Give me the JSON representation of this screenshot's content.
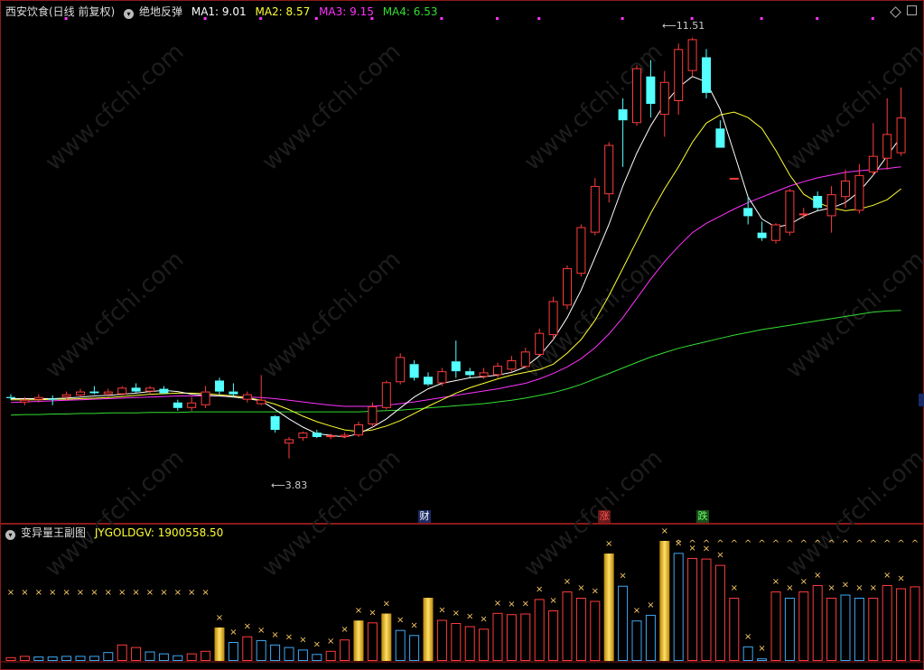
{
  "main_header": {
    "title": "西安饮食(日线 前复权)",
    "indicator_name": "绝地反弹",
    "ma1": "MA1: 9.01",
    "ma2": "MA2: 8.57",
    "ma3": "MA3: 9.15",
    "ma4": "MA4: 6.53"
  },
  "sub_header": {
    "title": "变异量王副图",
    "value": "JYGOLDGV: 1900558.50"
  },
  "markers": {
    "high_label": "11.51",
    "low_label": "3.83",
    "cai": "财",
    "zhang": "涨",
    "die": "跌"
  },
  "watermark": "www.cfchi.com",
  "colors": {
    "up": "#ff3c3c",
    "down": "#54ffff",
    "ma1": "#ffffff",
    "ma2": "#ffff33",
    "ma3": "#ff33ff",
    "ma4": "#33dd33",
    "frame": "#8b1a1a",
    "gold": "#f2c12e",
    "vol_up": "#ff3c3c",
    "vol_down": "#3fa9f5"
  },
  "chart_data": {
    "type": "candlestick",
    "price_range": [
      3.0,
      11.8
    ],
    "candles": [
      {
        "o": 4.95,
        "h": 5.0,
        "l": 4.9,
        "c": 4.93
      },
      {
        "o": 4.85,
        "h": 4.95,
        "l": 4.8,
        "c": 4.9
      },
      {
        "o": 4.9,
        "h": 5.0,
        "l": 4.85,
        "c": 4.95
      },
      {
        "o": 4.92,
        "h": 4.98,
        "l": 4.8,
        "c": 4.9
      },
      {
        "o": 4.95,
        "h": 5.05,
        "l": 4.9,
        "c": 5.0
      },
      {
        "o": 4.98,
        "h": 5.1,
        "l": 4.95,
        "c": 5.05
      },
      {
        "o": 5.05,
        "h": 5.15,
        "l": 5.0,
        "c": 5.02
      },
      {
        "o": 5.0,
        "h": 5.1,
        "l": 4.95,
        "c": 5.05
      },
      {
        "o": 5.0,
        "h": 5.15,
        "l": 4.98,
        "c": 5.12
      },
      {
        "o": 5.12,
        "h": 5.2,
        "l": 5.02,
        "c": 5.05
      },
      {
        "o": 5.05,
        "h": 5.15,
        "l": 5.0,
        "c": 5.12
      },
      {
        "o": 5.1,
        "h": 5.15,
        "l": 5.0,
        "c": 5.02
      },
      {
        "o": 4.85,
        "h": 4.9,
        "l": 4.7,
        "c": 4.75
      },
      {
        "o": 4.75,
        "h": 4.95,
        "l": 4.7,
        "c": 4.85
      },
      {
        "o": 4.8,
        "h": 5.15,
        "l": 4.75,
        "c": 5.05
      },
      {
        "o": 5.25,
        "h": 5.3,
        "l": 5.0,
        "c": 5.05
      },
      {
        "o": 5.05,
        "h": 5.2,
        "l": 4.95,
        "c": 5.0
      },
      {
        "o": 4.9,
        "h": 5.05,
        "l": 4.85,
        "c": 5.0
      },
      {
        "o": 4.82,
        "h": 5.35,
        "l": 4.8,
        "c": 4.9
      },
      {
        "o": 4.6,
        "h": 4.62,
        "l": 4.3,
        "c": 4.35
      },
      {
        "o": 4.1,
        "h": 4.22,
        "l": 3.83,
        "c": 4.18
      },
      {
        "o": 4.2,
        "h": 4.32,
        "l": 4.15,
        "c": 4.3
      },
      {
        "o": 4.3,
        "h": 4.35,
        "l": 4.2,
        "c": 4.22
      },
      {
        "o": 4.22,
        "h": 4.28,
        "l": 4.18,
        "c": 4.25
      },
      {
        "o": 4.22,
        "h": 4.3,
        "l": 4.2,
        "c": 4.26
      },
      {
        "o": 4.25,
        "h": 4.5,
        "l": 4.22,
        "c": 4.45
      },
      {
        "o": 4.45,
        "h": 4.85,
        "l": 4.4,
        "c": 4.78
      },
      {
        "o": 4.75,
        "h": 5.25,
        "l": 4.72,
        "c": 5.22
      },
      {
        "o": 5.22,
        "h": 5.75,
        "l": 5.18,
        "c": 5.68
      },
      {
        "o": 5.55,
        "h": 5.62,
        "l": 5.25,
        "c": 5.3
      },
      {
        "o": 5.32,
        "h": 5.4,
        "l": 5.15,
        "c": 5.18
      },
      {
        "o": 5.2,
        "h": 5.48,
        "l": 5.15,
        "c": 5.42
      },
      {
        "o": 5.6,
        "h": 5.98,
        "l": 5.3,
        "c": 5.42
      },
      {
        "o": 5.42,
        "h": 5.48,
        "l": 5.3,
        "c": 5.35
      },
      {
        "o": 5.32,
        "h": 5.48,
        "l": 5.28,
        "c": 5.4
      },
      {
        "o": 5.35,
        "h": 5.58,
        "l": 5.3,
        "c": 5.52
      },
      {
        "o": 5.45,
        "h": 5.7,
        "l": 5.4,
        "c": 5.62
      },
      {
        "o": 5.5,
        "h": 5.85,
        "l": 5.48,
        "c": 5.78
      },
      {
        "o": 5.72,
        "h": 6.2,
        "l": 5.7,
        "c": 6.12
      },
      {
        "o": 6.08,
        "h": 6.78,
        "l": 6.0,
        "c": 6.7
      },
      {
        "o": 6.62,
        "h": 7.35,
        "l": 6.55,
        "c": 7.3
      },
      {
        "o": 7.2,
        "h": 8.1,
        "l": 7.15,
        "c": 8.05
      },
      {
        "o": 7.95,
        "h": 8.95,
        "l": 7.9,
        "c": 8.8
      },
      {
        "o": 8.65,
        "h": 9.6,
        "l": 8.5,
        "c": 9.55
      },
      {
        "o": 10.2,
        "h": 10.4,
        "l": 9.15,
        "c": 10.0
      },
      {
        "o": 9.95,
        "h": 11.0,
        "l": 9.9,
        "c": 10.95
      },
      {
        "o": 10.8,
        "h": 11.1,
        "l": 10.05,
        "c": 10.3
      },
      {
        "o": 10.1,
        "h": 10.9,
        "l": 9.7,
        "c": 10.7
      },
      {
        "o": 10.35,
        "h": 11.4,
        "l": 10.1,
        "c": 11.3
      },
      {
        "o": 10.9,
        "h": 11.51,
        "l": 10.8,
        "c": 11.48
      },
      {
        "o": 11.15,
        "h": 11.3,
        "l": 10.4,
        "c": 10.5
      },
      {
        "o": 9.85,
        "h": 10.0,
        "l": 9.5,
        "c": 9.5
      },
      {
        "o": 8.95,
        "h": 8.95,
        "l": 8.95,
        "c": 8.95
      },
      {
        "o": 8.4,
        "h": 8.6,
        "l": 8.1,
        "c": 8.25
      },
      {
        "o": 7.95,
        "h": 8.15,
        "l": 7.8,
        "c": 7.85
      },
      {
        "o": 7.8,
        "h": 8.12,
        "l": 7.75,
        "c": 8.1
      },
      {
        "o": 7.95,
        "h": 8.75,
        "l": 7.9,
        "c": 8.72
      },
      {
        "o": 8.3,
        "h": 8.4,
        "l": 8.2,
        "c": 8.3
      },
      {
        "o": 8.62,
        "h": 8.7,
        "l": 8.35,
        "c": 8.4
      },
      {
        "o": 8.25,
        "h": 8.8,
        "l": 7.95,
        "c": 8.65
      },
      {
        "o": 8.6,
        "h": 9.1,
        "l": 8.4,
        "c": 8.9
      },
      {
        "o": 8.35,
        "h": 9.2,
        "l": 8.3,
        "c": 9.0
      },
      {
        "o": 9.05,
        "h": 9.95,
        "l": 9.0,
        "c": 9.35
      },
      {
        "o": 9.3,
        "h": 10.4,
        "l": 9.1,
        "c": 9.75
      },
      {
        "o": 9.4,
        "h": 10.6,
        "l": 9.35,
        "c": 10.05
      }
    ],
    "ma1": [
      4.92,
      4.92,
      4.92,
      4.92,
      4.93,
      4.95,
      4.97,
      4.98,
      5.0,
      5.02,
      5.05,
      5.07,
      5.05,
      5.0,
      4.98,
      4.97,
      4.95,
      4.92,
      4.88,
      4.72,
      4.55,
      4.4,
      4.28,
      4.25,
      4.22,
      4.28,
      4.4,
      4.55,
      4.75,
      4.95,
      5.1,
      5.2,
      5.25,
      5.3,
      5.32,
      5.35,
      5.4,
      5.5,
      5.7,
      6.0,
      6.4,
      6.9,
      7.5,
      8.1,
      8.8,
      9.4,
      9.9,
      10.3,
      10.6,
      10.8,
      10.7,
      10.2,
      9.4,
      8.6,
      8.2,
      8.05,
      8.1,
      8.25,
      8.35,
      8.4,
      8.5,
      8.7,
      9.0,
      9.35,
      9.7
    ],
    "ma2": [
      4.9,
      4.9,
      4.9,
      4.91,
      4.91,
      4.92,
      4.93,
      4.94,
      4.96,
      4.98,
      5.0,
      5.01,
      5.02,
      5.02,
      5.01,
      4.99,
      4.97,
      4.94,
      4.89,
      4.82,
      4.72,
      4.6,
      4.5,
      4.42,
      4.35,
      4.32,
      4.35,
      4.42,
      4.52,
      4.65,
      4.78,
      4.9,
      5.02,
      5.12,
      5.2,
      5.28,
      5.35,
      5.4,
      5.45,
      5.55,
      5.75,
      6.0,
      6.35,
      6.8,
      7.3,
      7.8,
      8.3,
      8.75,
      9.15,
      9.6,
      9.95,
      10.1,
      10.15,
      10.05,
      9.85,
      9.45,
      9.0,
      8.65,
      8.5,
      8.4,
      8.35,
      8.38,
      8.45,
      8.55,
      8.75
    ],
    "ma3": [
      4.85,
      4.86,
      4.87,
      4.88,
      4.89,
      4.9,
      4.91,
      4.92,
      4.93,
      4.94,
      4.95,
      4.96,
      4.97,
      4.97,
      4.97,
      4.97,
      4.96,
      4.95,
      4.94,
      4.92,
      4.89,
      4.86,
      4.83,
      4.8,
      4.78,
      4.78,
      4.78,
      4.8,
      4.83,
      4.86,
      4.9,
      4.94,
      4.98,
      5.02,
      5.06,
      5.1,
      5.15,
      5.2,
      5.28,
      5.38,
      5.5,
      5.65,
      5.85,
      6.1,
      6.4,
      6.75,
      7.1,
      7.42,
      7.7,
      7.95,
      8.12,
      8.25,
      8.38,
      8.5,
      8.6,
      8.7,
      8.8,
      8.88,
      8.95,
      9.0,
      9.05,
      9.08,
      9.1,
      9.12,
      9.15
    ],
    "ma4": [
      4.62,
      4.63,
      4.63,
      4.64,
      4.64,
      4.65,
      4.65,
      4.66,
      4.66,
      4.66,
      4.67,
      4.67,
      4.67,
      4.68,
      4.68,
      4.68,
      4.68,
      4.68,
      4.68,
      4.68,
      4.68,
      4.68,
      4.68,
      4.68,
      4.68,
      4.68,
      4.69,
      4.7,
      4.71,
      4.73,
      4.75,
      4.77,
      4.79,
      4.81,
      4.83,
      4.86,
      4.89,
      4.93,
      4.98,
      5.03,
      5.1,
      5.18,
      5.28,
      5.38,
      5.48,
      5.58,
      5.68,
      5.76,
      5.84,
      5.9,
      5.96,
      6.02,
      6.08,
      6.13,
      6.18,
      6.22,
      6.26,
      6.3,
      6.34,
      6.38,
      6.42,
      6.46,
      6.5,
      6.52,
      6.53
    ],
    "volume_range": [
      0,
      1900558.5
    ],
    "volume": [
      {
        "v": 60000,
        "t": "u"
      },
      {
        "v": 80000,
        "t": "u"
      },
      {
        "v": 70000,
        "t": "d"
      },
      {
        "v": 70000,
        "t": "d"
      },
      {
        "v": 80000,
        "t": "d"
      },
      {
        "v": 80000,
        "t": "d"
      },
      {
        "v": 80000,
        "t": "d"
      },
      {
        "v": 140000,
        "t": "d"
      },
      {
        "v": 260000,
        "t": "u"
      },
      {
        "v": 220000,
        "t": "u"
      },
      {
        "v": 150000,
        "t": "d"
      },
      {
        "v": 120000,
        "t": "d"
      },
      {
        "v": 90000,
        "t": "d"
      },
      {
        "v": 120000,
        "t": "u"
      },
      {
        "v": 160000,
        "t": "u"
      },
      {
        "v": 530000,
        "t": "g"
      },
      {
        "v": 300000,
        "t": "d"
      },
      {
        "v": 390000,
        "t": "u"
      },
      {
        "v": 330000,
        "t": "d"
      },
      {
        "v": 260000,
        "t": "d"
      },
      {
        "v": 220000,
        "t": "d"
      },
      {
        "v": 180000,
        "t": "d"
      },
      {
        "v": 110000,
        "t": "d"
      },
      {
        "v": 160000,
        "t": "u"
      },
      {
        "v": 340000,
        "t": "u"
      },
      {
        "v": 640000,
        "t": "g"
      },
      {
        "v": 610000,
        "t": "u"
      },
      {
        "v": 750000,
        "t": "g"
      },
      {
        "v": 490000,
        "t": "d"
      },
      {
        "v": 410000,
        "t": "d"
      },
      {
        "v": 1000000,
        "t": "g"
      },
      {
        "v": 650000,
        "t": "u"
      },
      {
        "v": 600000,
        "t": "u"
      },
      {
        "v": 550000,
        "t": "u"
      },
      {
        "v": 510000,
        "t": "u"
      },
      {
        "v": 760000,
        "t": "u"
      },
      {
        "v": 740000,
        "t": "u"
      },
      {
        "v": 750000,
        "t": "u"
      },
      {
        "v": 980000,
        "t": "u"
      },
      {
        "v": 800000,
        "t": "u"
      },
      {
        "v": 1100000,
        "t": "u"
      },
      {
        "v": 1000000,
        "t": "u"
      },
      {
        "v": 950000,
        "t": "u"
      },
      {
        "v": 1700000,
        "t": "g"
      },
      {
        "v": 1190000,
        "t": "d"
      },
      {
        "v": 640000,
        "t": "d"
      },
      {
        "v": 730000,
        "t": "d"
      },
      {
        "v": 1900558.5,
        "t": "g"
      },
      {
        "v": 1710000,
        "t": "d"
      },
      {
        "v": 1630000,
        "t": "u"
      },
      {
        "v": 1620000,
        "t": "u"
      },
      {
        "v": 1520000,
        "t": "u"
      },
      {
        "v": 1000000,
        "t": "u"
      },
      {
        "v": 230000,
        "t": "d"
      },
      {
        "v": 40000,
        "t": "d"
      },
      {
        "v": 1100000,
        "t": "u"
      },
      {
        "v": 1000000,
        "t": "d"
      },
      {
        "v": 1100000,
        "t": "u"
      },
      {
        "v": 1200000,
        "t": "u"
      },
      {
        "v": 1000000,
        "t": "u"
      },
      {
        "v": 1050000,
        "t": "d"
      },
      {
        "v": 1000000,
        "t": "d"
      },
      {
        "v": 1000000,
        "t": "u"
      },
      {
        "v": 1200000,
        "t": "u"
      },
      {
        "v": 1150000,
        "t": "u"
      },
      {
        "v": 1180000,
        "t": "u"
      }
    ],
    "x_markers": [
      0,
      1,
      2,
      3,
      4,
      5,
      6,
      7,
      8,
      9,
      10,
      11,
      12,
      13,
      14,
      15,
      16,
      17,
      18,
      19,
      20,
      21,
      22,
      23,
      24,
      25,
      26,
      27,
      28,
      29,
      31,
      32,
      33,
      34,
      35,
      36,
      37,
      38,
      39,
      40,
      41,
      42,
      43,
      44,
      45,
      46,
      47,
      48,
      49,
      50,
      51,
      52,
      53,
      54,
      55,
      56,
      57,
      58,
      59,
      60,
      61,
      62,
      63,
      64
    ],
    "caret_markers": [
      48,
      49,
      50,
      51,
      52,
      53,
      54,
      55,
      56,
      57,
      58,
      59,
      60,
      61,
      62,
      63,
      64,
      65
    ],
    "top_dots": [
      4,
      14,
      18,
      22,
      26,
      31,
      35,
      38,
      44,
      49,
      54,
      58,
      62
    ]
  }
}
